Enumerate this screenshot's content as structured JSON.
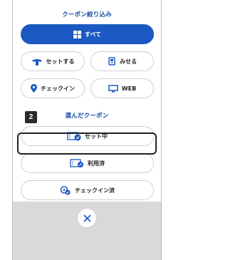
{
  "filter": {
    "title": "クーポン絞り込み",
    "all_label": "すべて",
    "set_label": "セットする",
    "show_label": "みせる",
    "checkin_label": "チェックイン",
    "web_label": "WEB"
  },
  "selected": {
    "title": "選んだクーポン",
    "set_in_progress_label": "セット中",
    "used_label": "利用済",
    "checked_in_label": "チェックイン済"
  },
  "step_number": "2",
  "colors": {
    "accent": "#1b58c2",
    "heading": "#1a4aa6"
  }
}
